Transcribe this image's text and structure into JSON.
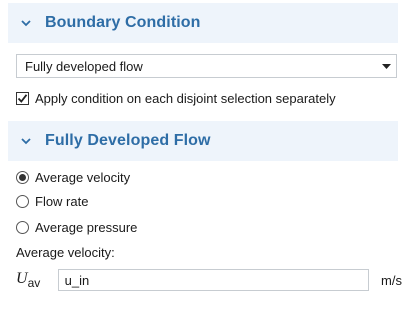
{
  "boundary_condition": {
    "title": "Boundary Condition",
    "select_value": "Fully developed flow",
    "checkbox_label": "Apply condition on each disjoint selection separately",
    "checkbox_checked": true
  },
  "fully_developed_flow": {
    "title": "Fully Developed Flow",
    "options": [
      {
        "label": "Average velocity",
        "selected": true
      },
      {
        "label": "Flow rate",
        "selected": false
      },
      {
        "label": "Average pressure",
        "selected": false
      }
    ],
    "field_label": "Average velocity:",
    "symbol": "U",
    "symbol_subscript": "av",
    "input_value": "u_in",
    "unit": "m/s"
  },
  "colors": {
    "header_bg": "#eef4fb",
    "header_text": "#2e6da6"
  }
}
